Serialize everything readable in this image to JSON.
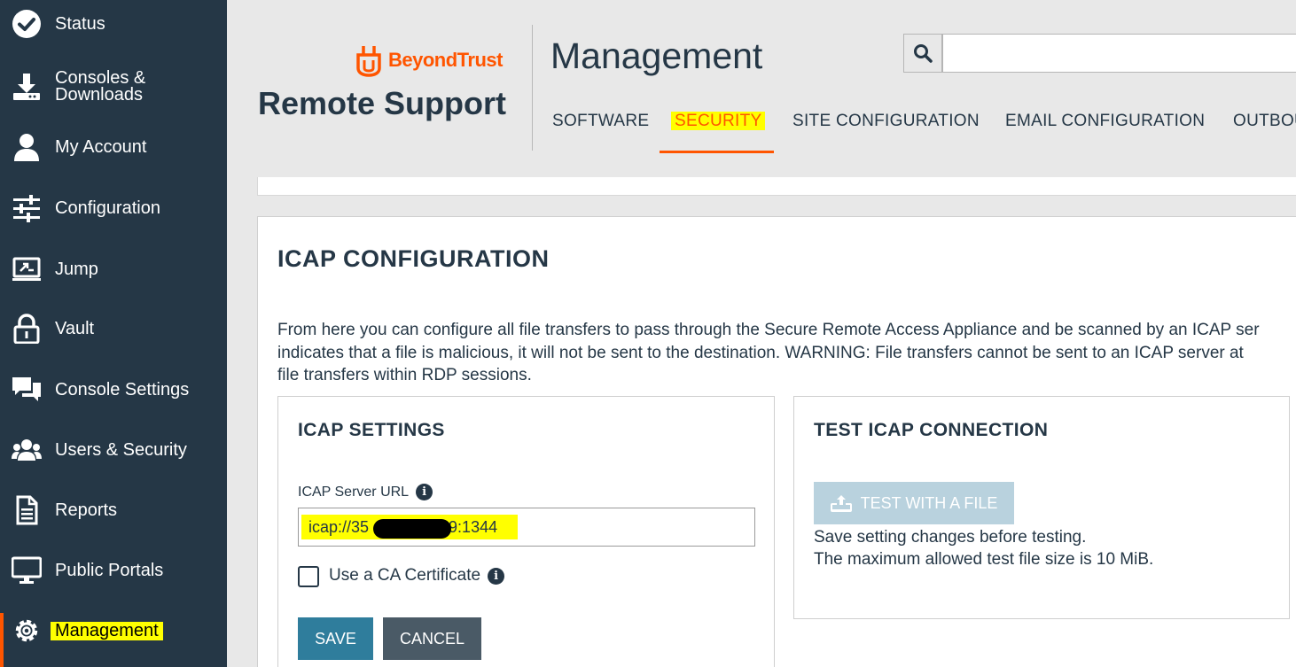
{
  "sidebar": {
    "items": [
      {
        "label": "Status",
        "icon": "check-circle-icon"
      },
      {
        "label": "Consoles &",
        "label2": "Downloads",
        "icon": "download-icon"
      },
      {
        "label": "My Account",
        "icon": "user-icon"
      },
      {
        "label": "Configuration",
        "icon": "sliders-icon"
      },
      {
        "label": "Jump",
        "icon": "jump-icon"
      },
      {
        "label": "Vault",
        "icon": "lock-icon"
      },
      {
        "label": "Console Settings",
        "icon": "chat-icon"
      },
      {
        "label": "Users & Security",
        "icon": "users-icon"
      },
      {
        "label": "Reports",
        "icon": "report-icon"
      },
      {
        "label": "Public Portals",
        "icon": "monitor-icon"
      },
      {
        "label": "Management",
        "icon": "gear-icon",
        "active": true
      }
    ]
  },
  "header": {
    "brand": "BeyondTrust",
    "product": "Remote Support",
    "title": "Management",
    "search": {
      "placeholder": "",
      "value": ""
    },
    "tabs": [
      {
        "label": "SOFTWARE"
      },
      {
        "label": "SECURITY",
        "active": true
      },
      {
        "label": "SITE CONFIGURATION"
      },
      {
        "label": "EMAIL CONFIGURATION"
      },
      {
        "label": "OUTBOU"
      }
    ]
  },
  "main": {
    "title": "ICAP CONFIGURATION",
    "description": [
      "From here you can configure all file transfers to pass through the Secure Remote Access Appliance and be scanned by an ICAP ser",
      "indicates that a file is malicious, it will not be sent to the destination. WARNING: File transfers cannot be sent to an ICAP server at",
      "file transfers within RDP sessions."
    ],
    "settings": {
      "title": "ICAP SETTINGS",
      "url_label": "ICAP Server URL",
      "url_value_start": "icap://35",
      "url_value_end": "9:1344",
      "ca_label": "Use a CA Certificate",
      "save_label": "SAVE",
      "cancel_label": "CANCEL"
    },
    "test": {
      "title": "TEST ICAP CONNECTION",
      "button_label": "TEST WITH A FILE",
      "note1": "Save setting changes before testing.",
      "note2": "The maximum allowed test file size is 10 MiB."
    }
  },
  "colors": {
    "sidebar": "#253746",
    "accent": "#ff5500",
    "highlight": "#ffff00",
    "primary_button": "#2f7d9c"
  }
}
